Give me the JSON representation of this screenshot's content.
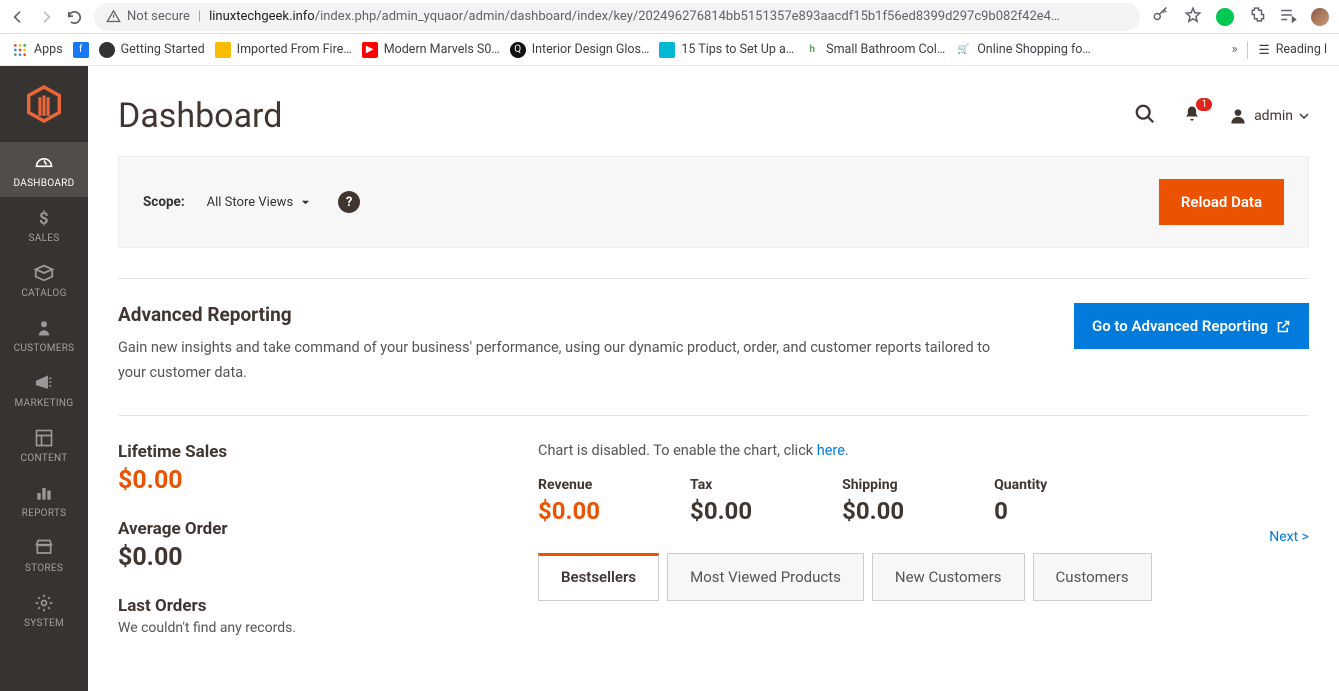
{
  "browser": {
    "not_secure": "Not secure",
    "url_domain": "linuxtechgeek.info",
    "url_path": "/index.php/admin_yquaor/admin/dashboard/index/key/2024962768​14bb5151357e893aacdf15b1f56ed8399d297c9b082f42e4…"
  },
  "bookmarks": {
    "apps": "Apps",
    "items": [
      "Getting Started",
      "Imported From Fire…",
      "Modern Marvels S0…",
      "Interior Design Glos…",
      "15 Tips to Set Up a…",
      "Small Bathroom Col…",
      "Online Shopping fo…"
    ],
    "reading": "Reading l"
  },
  "sidebar": {
    "items": [
      {
        "label": "DASHBOARD"
      },
      {
        "label": "SALES"
      },
      {
        "label": "CATALOG"
      },
      {
        "label": "CUSTOMERS"
      },
      {
        "label": "MARKETING"
      },
      {
        "label": "CONTENT"
      },
      {
        "label": "REPORTS"
      },
      {
        "label": "STORES"
      },
      {
        "label": "SYSTEM"
      }
    ]
  },
  "header": {
    "title": "Dashboard",
    "notif_count": "1",
    "user": "admin"
  },
  "scope": {
    "label": "Scope:",
    "value": "All Store Views",
    "reload": "Reload Data"
  },
  "adv": {
    "title": "Advanced Reporting",
    "desc": "Gain new insights and take command of your business' performance, using our dynamic product, order, and customer reports tailored to your customer data.",
    "button": "Go to Advanced Reporting"
  },
  "stats": {
    "lifetime_label": "Lifetime Sales",
    "lifetime_value": "$0.00",
    "avg_label": "Average Order",
    "avg_value": "$0.00",
    "last_orders_label": "Last Orders",
    "last_orders_empty": "We couldn't find any records."
  },
  "chart": {
    "msg_pre": "Chart is disabled. To enable the chart, click ",
    "msg_link": "here",
    "msg_post": "."
  },
  "metrics": [
    {
      "label": "Revenue",
      "value": "$0.00",
      "color": "orange"
    },
    {
      "label": "Tax",
      "value": "$0.00",
      "color": "black"
    },
    {
      "label": "Shipping",
      "value": "$0.00",
      "color": "black"
    },
    {
      "label": "Quantity",
      "value": "0",
      "color": "black"
    }
  ],
  "tabs": {
    "items": [
      "Bestsellers",
      "Most Viewed Products",
      "New Customers",
      "Customers"
    ],
    "next": "Next >"
  }
}
